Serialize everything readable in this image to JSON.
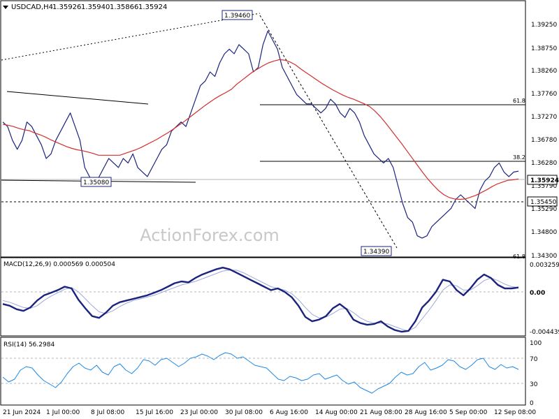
{
  "chart_data": [
    {
      "type": "line",
      "panel": "price",
      "title": "USDCAD,H4",
      "ohlc": [
        "1.35926",
        "1.35940",
        "1.35866",
        "1.35924"
      ],
      "watermark": "ActionForex.com",
      "y_ticks": [
        "1.39250",
        "1.38750",
        "1.38260",
        "1.37760",
        "1.37270",
        "1.36780",
        "1.36280",
        "1.35790",
        "1.35290",
        "1.34800",
        "1.34300"
      ],
      "ylim": [
        1.3405,
        1.3965
      ],
      "current_price_label": "1.35924",
      "current_price": 1.35924,
      "level_labels": [
        "1.35450"
      ],
      "level_values": [
        1.3545
      ],
      "annotations": [
        {
          "text": "1.39460",
          "x": 88,
          "y": 1.3946
        },
        {
          "text": "1.35080",
          "x": 26,
          "y": 1.3508
        },
        {
          "text": "1.34390",
          "x": 146,
          "y": 1.3439
        }
      ],
      "fib_labels": [
        {
          "text": "61.8",
          "value": 1.3751
        },
        {
          "text": "38.2",
          "value": 1.3633
        },
        {
          "text": "61.8",
          "value": 1.3424
        }
      ],
      "x_ticks": [
        "21 Jun 2024",
        "1 Jul 00:00",
        "8 Jul 08:00",
        "15 Jul 16:00",
        "23 Jul 00:00",
        "30 Jul 08:00",
        "6 Aug 16:00",
        "14 Aug 00:00",
        "21 Aug 08:00",
        "28 Aug 16:00",
        "5 Sep 00:00",
        "12 Sep 08:00"
      ],
      "series": [
        {
          "values": [
            1.37,
            1.369,
            1.366,
            1.364,
            1.366,
            1.37,
            1.369,
            1.367,
            1.365,
            1.362,
            1.363,
            1.366,
            1.368,
            1.37,
            1.372,
            1.369,
            1.366,
            1.36,
            1.358,
            1.356,
            1.358,
            1.36,
            1.362,
            1.361,
            1.36,
            1.362,
            1.361,
            1.363,
            1.36,
            1.359,
            1.358,
            1.36,
            1.362,
            1.364,
            1.365,
            1.368,
            1.369,
            1.37,
            1.369,
            1.372,
            1.375,
            1.378,
            1.379,
            1.381,
            1.38,
            1.383,
            1.385,
            1.386,
            1.385,
            1.387,
            1.386,
            1.385,
            1.381,
            1.382,
            1.387,
            1.39,
            1.388,
            1.386,
            1.382,
            1.38,
            1.378,
            1.376,
            1.375,
            1.374,
            1.374,
            1.373,
            1.372,
            1.373,
            1.375,
            1.374,
            1.372,
            1.371,
            1.373,
            1.372,
            1.37,
            1.367,
            1.365,
            1.363,
            1.362,
            1.361,
            1.362,
            1.36,
            1.356,
            1.352,
            1.349,
            1.348,
            1.345,
            1.3445,
            1.345,
            1.347,
            1.348,
            1.349,
            1.35,
            1.351,
            1.353,
            1.354,
            1.353,
            1.352,
            1.351,
            1.355,
            1.357,
            1.358,
            1.36,
            1.361,
            1.359,
            1.358,
            1.359,
            1.3592
          ]
        },
        {
          "values": [
            1.3695,
            1.3693,
            1.369,
            1.3686,
            1.3683,
            1.3681,
            1.3676,
            1.3672,
            1.3667,
            1.3661,
            1.3656,
            1.3651,
            1.3646,
            1.3642,
            1.3639,
            1.3637,
            1.3634,
            1.3631,
            1.3627,
            1.3627,
            1.3627,
            1.3627,
            1.3627,
            1.3631,
            1.3635,
            1.3639,
            1.3644,
            1.365,
            1.3656,
            1.3662,
            1.3669,
            1.3676,
            1.3684,
            1.3692,
            1.37,
            1.3709,
            1.3718,
            1.3727,
            1.3736,
            1.3744,
            1.3752,
            1.3759,
            1.3765,
            1.3772,
            1.3783,
            1.3792,
            1.3801,
            1.381,
            1.3817,
            1.3824,
            1.383,
            1.3834,
            1.3837,
            1.3836,
            1.3832,
            1.3826,
            1.3817,
            1.3809,
            1.3801,
            1.3793,
            1.3785,
            1.3778,
            1.3771,
            1.3765,
            1.3759,
            1.3754,
            1.375,
            1.3745,
            1.374,
            1.3734,
            1.3724,
            1.3712,
            1.3698,
            1.3683,
            1.3668,
            1.3653,
            1.3637,
            1.3621,
            1.3605,
            1.3589,
            1.3574,
            1.3561,
            1.3549,
            1.354,
            1.3534,
            1.3531,
            1.353,
            1.3531,
            1.3535,
            1.3539,
            1.3545,
            1.3551,
            1.3558,
            1.3564,
            1.3568,
            1.3572,
            1.3573,
            1.3575
          ]
        }
      ]
    },
    {
      "type": "line",
      "panel": "macd",
      "title": "MACD(12,26,9) 0.000569 0.000504",
      "y_ticks": [
        "0.003259",
        "0.00",
        "-0.004439"
      ],
      "ylim": [
        -0.0046,
        0.0041
      ],
      "series": [
        {
          "values": [
            -0.001,
            -0.0012,
            -0.0016,
            -0.0018,
            -0.0014,
            -0.0006,
            0.0,
            0.0003,
            0.0006,
            0.001,
            0.0008,
            -0.0005,
            -0.0015,
            -0.0024,
            -0.0026,
            -0.002,
            -0.0012,
            -0.0008,
            -0.0006,
            -0.0004,
            -0.0002,
            0.0,
            0.0003,
            0.0006,
            0.001,
            0.0014,
            0.0016,
            0.0015,
            0.002,
            0.0024,
            0.0027,
            0.003,
            0.0032,
            0.003,
            0.0026,
            0.0022,
            0.0018,
            0.0014,
            0.001,
            0.0006,
            0.0008,
            0.0004,
            -0.0002,
            -0.0012,
            -0.0025,
            -0.003,
            -0.0028,
            -0.0024,
            -0.0015,
            -0.001,
            -0.0016,
            -0.0028,
            -0.0032,
            -0.0034,
            -0.0033,
            -0.003,
            -0.0036,
            -0.004,
            -0.0042,
            -0.0041,
            -0.003,
            -0.0014,
            -0.0006,
            0.0004,
            0.0018,
            0.0016,
            0.0006,
            0.0,
            0.0008,
            0.0018,
            0.0024,
            0.002,
            0.0012,
            0.0008,
            0.0008,
            0.0009
          ]
        },
        {
          "values": [
            -0.0006,
            -0.0008,
            -0.0011,
            -0.0014,
            -0.0015,
            -0.0012,
            -0.0006,
            -0.0001,
            0.0003,
            0.0007,
            0.0009,
            0.0004,
            -0.0004,
            -0.0012,
            -0.0019,
            -0.0021,
            -0.0018,
            -0.0013,
            -0.0009,
            -0.0006,
            -0.0004,
            -0.0002,
            0.0,
            0.0003,
            0.0006,
            0.0009,
            0.0012,
            0.0014,
            0.0016,
            0.0019,
            0.0022,
            0.0025,
            0.0028,
            0.0029,
            0.0029,
            0.0026,
            0.0022,
            0.0018,
            0.0014,
            0.001,
            0.0008,
            0.0006,
            0.0002,
            -0.0005,
            -0.0014,
            -0.0022,
            -0.0026,
            -0.0025,
            -0.0021,
            -0.0016,
            -0.0015,
            -0.002,
            -0.0026,
            -0.003,
            -0.0032,
            -0.0032,
            -0.0033,
            -0.0036,
            -0.0039,
            -0.0041,
            -0.0037,
            -0.0027,
            -0.0017,
            -0.0006,
            0.0006,
            0.0012,
            0.0011,
            0.0006,
            0.0006,
            0.0011,
            0.0017,
            0.002,
            0.0017,
            0.0013,
            0.001,
            0.0009
          ]
        }
      ]
    },
    {
      "type": "line",
      "panel": "rsi",
      "title": "RSI(14) 56.2984",
      "y_ticks": [
        "100",
        "70",
        "30",
        "0"
      ],
      "ylim": [
        0,
        100
      ],
      "series": [
        {
          "values": [
            45,
            38,
            42,
            55,
            60,
            58,
            48,
            40,
            35,
            30,
            38,
            50,
            60,
            65,
            58,
            55,
            62,
            52,
            48,
            60,
            64,
            55,
            50,
            58,
            70,
            68,
            62,
            70,
            72,
            66,
            60,
            65,
            72,
            74,
            78,
            75,
            70,
            76,
            80,
            78,
            72,
            74,
            68,
            62,
            60,
            58,
            50,
            42,
            40,
            46,
            44,
            40,
            42,
            48,
            50,
            42,
            45,
            48,
            40,
            35,
            38,
            30,
            26,
            22,
            28,
            32,
            36,
            45,
            52,
            48,
            50,
            60,
            66,
            55,
            58,
            62,
            70,
            68,
            60,
            56,
            62,
            70,
            72,
            60,
            56,
            63,
            58,
            60,
            56
          ]
        }
      ]
    }
  ]
}
